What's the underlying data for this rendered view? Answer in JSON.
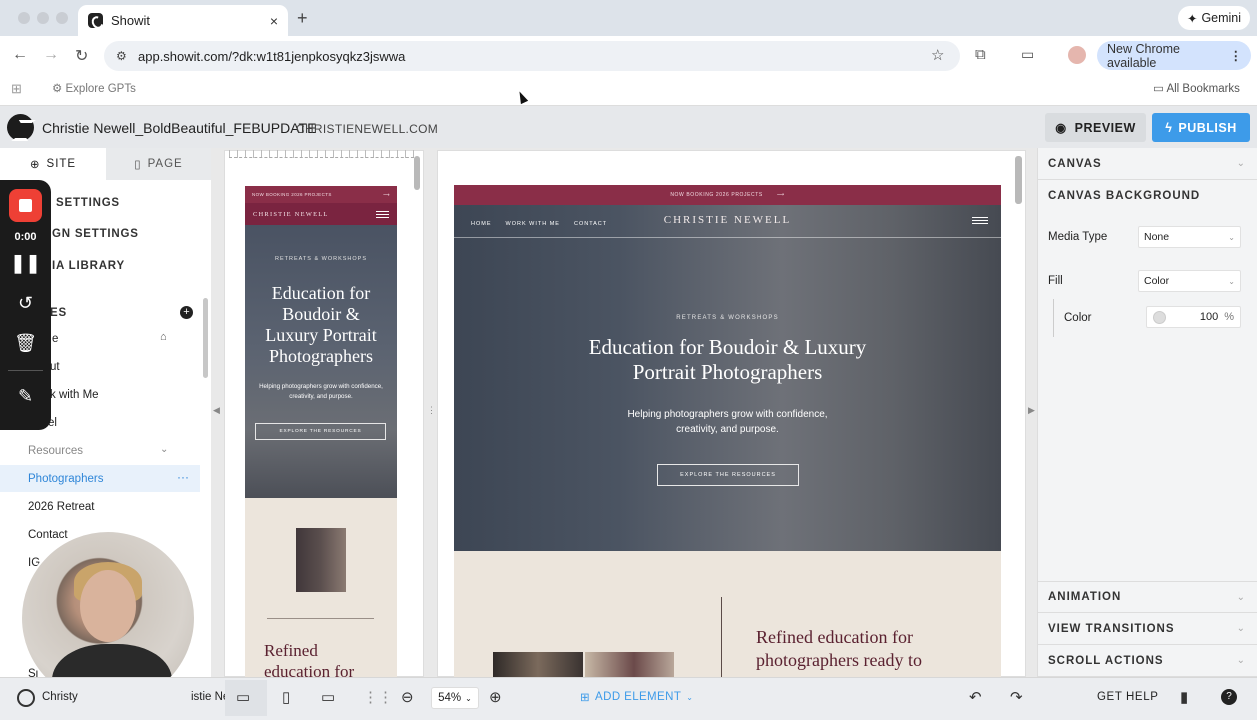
{
  "browser": {
    "tab_title": "Showit",
    "tab_close": "×",
    "new_tab": "+",
    "gemini_label": "Gemini",
    "url": "app.showit.com/?dk:w1t81jenpkosyqkz3jswwa",
    "new_chrome_label": "New Chrome available",
    "bookmark_explore": "Explore GPTs",
    "bookmark_all": "All Bookmarks"
  },
  "header": {
    "site_title": "Christie Newell_BoldBeautiful_FEBUPDATE",
    "domain": "CHRISTIENEWELL.COM",
    "preview_label": "PREVIEW",
    "publish_label": "PUBLISH"
  },
  "sidebar": {
    "tab_site": "SITE",
    "tab_page": "PAGE",
    "settings": [
      "SETTINGS",
      "IGN SETTINGS",
      "IA LIBRARY"
    ],
    "pages_heading": "ES",
    "pages": [
      "e",
      "ut",
      "k with Me",
      "el",
      "Resources",
      "Photographers",
      "2026 Retreat",
      "Contact",
      "IG"
    ],
    "bottom_partial": "Si",
    "user_name": "Christy",
    "user_name_paren": "istie Newell)"
  },
  "recorder": {
    "time": "0:00"
  },
  "mobile_preview": {
    "top_bar": "NOW BOOKING 2026 PROJECTS",
    "top_arrow": "⟶",
    "brand": "CHRISTIE NEWELL",
    "tag": "RETREATS & WORKSHOPS",
    "headline": "Education for Boudoir & Luxury Portrait Photographers",
    "sub": "Helping photographers grow with confidence, creativity, and purpose.",
    "button": "EXPLORE THE RESOURCES",
    "h2": "Refined education for"
  },
  "desktop_preview": {
    "top_bar": "NOW BOOKING 2026 PROJECTS",
    "top_arrow": "⟶",
    "nav": [
      "HOME",
      "WORK WITH ME",
      "CONTACT"
    ],
    "brand": "CHRISTIE NEWELL",
    "tag": "RETREATS & WORKSHOPS",
    "headline": "Education for Boudoir & Luxury Portrait Photographers",
    "sub": "Helping photographers grow with confidence, creativity, and purpose.",
    "button": "EXPLORE THE RESOURCES",
    "h2": "Refined education for photographers ready to"
  },
  "right_panel": {
    "canvas": "CANVAS",
    "canvas_background": "CANVAS BACKGROUND",
    "media_type_label": "Media Type",
    "media_type_value": "None",
    "fill_label": "Fill",
    "fill_value": "Color",
    "color_label": "Color",
    "color_opacity": "100",
    "color_pct": "%",
    "animation": "ANIMATION",
    "view_transitions": "VIEW TRANSITIONS",
    "scroll_actions": "SCROLL ACTIONS"
  },
  "bottom_bar": {
    "zoom": "54%",
    "add_element": "ADD ELEMENT",
    "get_help": "GET HELP"
  },
  "colors": {
    "accent": "#3d9be9",
    "brand_burgundy": "#8a2e48",
    "record_red": "#ee4035"
  }
}
